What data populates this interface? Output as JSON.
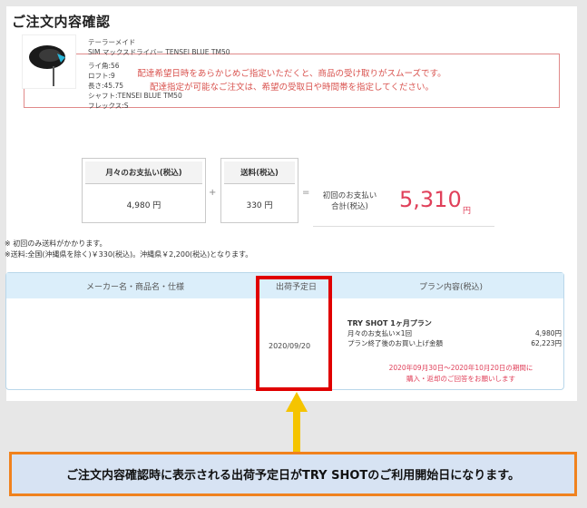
{
  "page_title": "ご注文内容確認",
  "notice": {
    "line1": "配達希望日時をあらかじめご指定いただくと、商品の受け取りがスムーズです。",
    "line2": "配達指定が可能なご注文は、希望の受取日や時間帯を指定してください。"
  },
  "summary": {
    "monthly_label": "月々のお支払い(税込)",
    "monthly_value": "4,980 円",
    "shipping_label": "送料(税込)",
    "shipping_value": "330 円",
    "plus": "+",
    "equals": "=",
    "total_label_1": "初回のお支払い",
    "total_label_2": "合計(税込)",
    "total_value": "5,310",
    "total_unit": "円"
  },
  "notes": {
    "line1": "※ 初回のみ送料がかかります。",
    "line2": "※送料:全国(沖縄県を除く)￥330(税込)。沖縄県￥2,200(税込)となります。"
  },
  "table": {
    "col_product": "メーカー名・商品名・仕様",
    "col_ship": "出荷予定日",
    "col_plan": "プラン内容(税込)",
    "product": {
      "maker": "テーラーメイド",
      "name": "SIM マックスドライバー TENSEI BLUE TM50",
      "spec1": "ライ角:56",
      "spec2": "ロフト:9",
      "spec3": "長さ:45.75",
      "spec4": "シャフト:TENSEI BLUE TM50",
      "spec5": "フレックス:S"
    },
    "ship_date": "2020/09/20",
    "plan": {
      "name": "TRY SHOT 1ヶ月プラン",
      "row1_label": "月々のお支払い×1回",
      "row1_value": "4,980円",
      "row2_label": "プラン終了後のお買い上げ金額",
      "row2_value": "62,223円",
      "period_1": "2020年09月30日～2020年10月20日の期間に",
      "period_2": "購入・返却のご回答をお願いします"
    }
  },
  "banner": "ご注文内容確認時に表示される出荷予定日がTRY SHOTのご利用開始日になります。",
  "colors": {
    "highlight": "#e00000",
    "arrow": "#f5c400",
    "banner_border": "#f0821e",
    "accent_red": "#e0405a"
  }
}
